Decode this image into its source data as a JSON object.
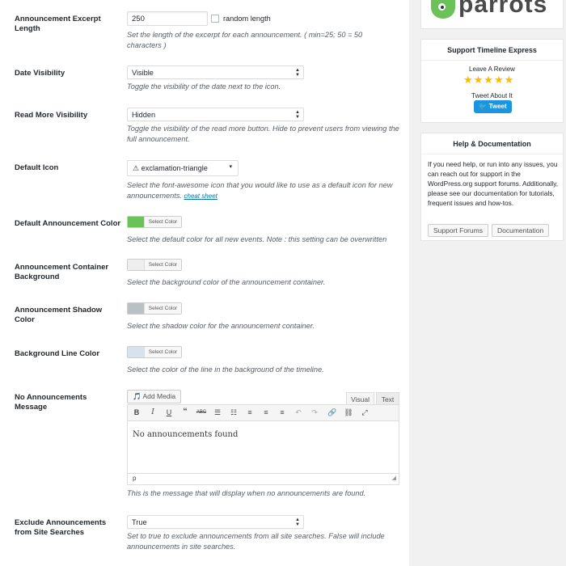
{
  "fields": {
    "excerpt_length": {
      "label": "Announcement Excerpt Length",
      "value": "250",
      "checkbox_label": "random length",
      "desc": "Set the length of the excerpt for each announcement. ( min=25; 50 = 50 characters )"
    },
    "date_visibility": {
      "label": "Date Visibility",
      "value": "Visible",
      "desc": "Toggle the visibility of the date next to the icon."
    },
    "read_more_visibility": {
      "label": "Read More Visibility",
      "value": "Hidden",
      "desc": "Toggle the visibility of the read more button. Hide to prevent users from viewing the full announcement."
    },
    "default_icon": {
      "label": "Default Icon",
      "value": "exclamation-triangle",
      "desc": "Select the font-awesome icon that you would like to use as a default icon for new announcements.",
      "link": "cheat sheet"
    },
    "default_color": {
      "label": "Default Announcement Color",
      "button": "Select Color",
      "color": "#6bc259",
      "desc": "Select the default color for all new events. Note : this setting can be overwritten"
    },
    "container_bg": {
      "label": "Announcement Container Background",
      "button": "Select Color",
      "color": "#eeeeee",
      "desc": "Select the background color of the announcement container."
    },
    "shadow_color": {
      "label": "Announcement Shadow Color",
      "button": "Select Color",
      "color": "#b7c1c6",
      "desc": "Select the shadow color for the announcement container."
    },
    "line_color": {
      "label": "Background Line Color",
      "button": "Select Color",
      "color": "#d6e2ee",
      "desc": "Select the color of the line in the background of the timeline."
    },
    "no_announcements": {
      "label": "No Announcements Message",
      "add_media": "Add Media",
      "tab_visual": "Visual",
      "tab_text": "Text",
      "content": "No announcements found",
      "status": "p",
      "desc": "This is the message that will display when no announcements are found."
    },
    "exclude_search": {
      "label": "Exclude Announcements from Site Searches",
      "value": "True",
      "desc": "Set to true to exclude announcements from all site searches. False will include announcements in site searches."
    }
  },
  "sidebar": {
    "logo_text": "parrots",
    "support": {
      "title": "Support Timeline Express",
      "review": "Leave A Review",
      "stars": "★★★★★",
      "tweet_about": "Tweet About It",
      "tweet_button": "Tweet"
    },
    "help": {
      "title": "Help & Documentation",
      "text": "If you need help, or run into any issues, you can reach out for support in the WordPress.org support forums. Additionally, please see our documentation for tutorials, frequent issues and how-tos.",
      "forums_button": "Support Forums",
      "docs_button": "Documentation"
    }
  },
  "colors": {
    "accent": "#0073aa",
    "tweet": "#1b95e0",
    "stars": "#ffb900"
  }
}
